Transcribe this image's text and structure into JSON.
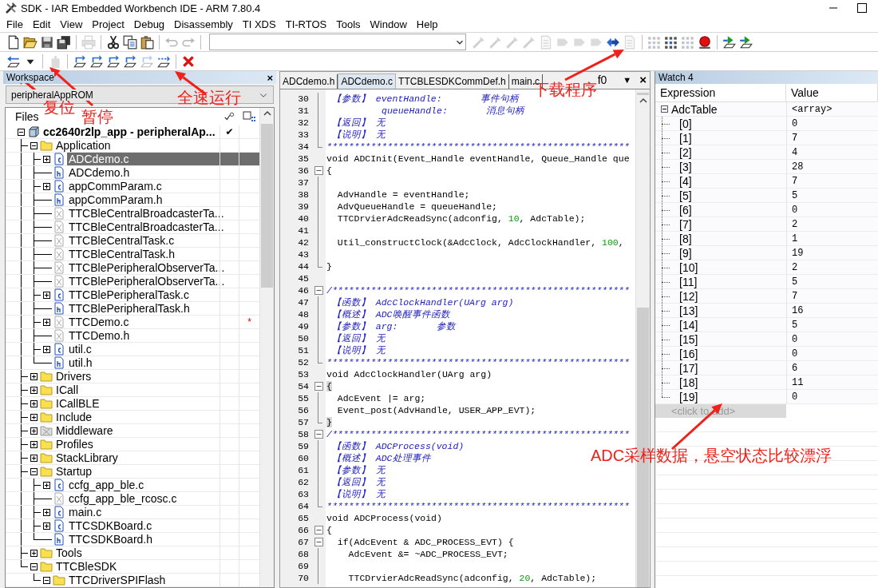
{
  "title_bar": {
    "title": "SDK - IAR Embedded Workbench IDE - ARM 7.80.4"
  },
  "menu": [
    "File",
    "Edit",
    "View",
    "Project",
    "Debug",
    "Disassembly",
    "TI XDS",
    "TI-RTOS",
    "Tools",
    "Window",
    "Help"
  ],
  "toolbars": [
    [
      {
        "kind": "new",
        "disabled": false
      },
      {
        "kind": "open",
        "disabled": false
      },
      {
        "kind": "save",
        "disabled": false
      },
      {
        "kind": "save_all",
        "disabled": false
      },
      {
        "kind": "sep"
      },
      {
        "kind": "print",
        "disabled": true
      },
      {
        "kind": "sep"
      },
      {
        "kind": "cut",
        "disabled": false
      },
      {
        "kind": "copy",
        "disabled": false
      },
      {
        "kind": "paste",
        "disabled": false
      },
      {
        "kind": "sep"
      },
      {
        "kind": "undo",
        "disabled": true
      },
      {
        "kind": "redo",
        "disabled": true
      },
      {
        "kind": "sep"
      },
      {
        "kind": "combo"
      },
      {
        "kind": "wand",
        "disabled": true
      },
      {
        "kind": "wand",
        "disabled": true
      },
      {
        "kind": "wand",
        "disabled": true
      },
      {
        "kind": "wand",
        "disabled": true
      },
      {
        "kind": "doc",
        "disabled": true
      },
      {
        "kind": "tag",
        "disabled": true
      },
      {
        "kind": "tag",
        "disabled": true
      },
      {
        "kind": "tag",
        "disabled": true
      },
      {
        "kind": "nav",
        "disabled": false
      },
      {
        "kind": "doc",
        "disabled": true
      },
      {
        "kind": "sep"
      },
      {
        "kind": "grid",
        "disabled": true
      },
      {
        "kind": "grid",
        "disabled": false
      },
      {
        "kind": "grid",
        "disabled": true
      },
      {
        "kind": "breakpoint",
        "disabled": false
      },
      {
        "kind": "sep"
      },
      {
        "kind": "download",
        "disabled": false
      },
      {
        "kind": "download",
        "disabled": false
      }
    ],
    [
      {
        "kind": "reset",
        "disabled": false
      },
      {
        "kind": "caret",
        "disabled": false
      },
      {
        "kind": "sep"
      },
      {
        "kind": "hand",
        "disabled": true
      },
      {
        "kind": "sep"
      },
      {
        "kind": "step",
        "disabled": false
      },
      {
        "kind": "step",
        "disabled": false
      },
      {
        "kind": "step",
        "disabled": false
      },
      {
        "kind": "step",
        "disabled": false
      },
      {
        "kind": "step",
        "disabled": true
      },
      {
        "kind": "run",
        "disabled": false
      },
      {
        "kind": "sep"
      },
      {
        "kind": "stop",
        "disabled": false
      }
    ]
  ],
  "workspace": {
    "title": "Workspace",
    "close": "×",
    "configuration": "peripheralAppROM",
    "files_header": "Files",
    "tree": [
      {
        "label": "cc2640r2lp_app - peripheralAp...",
        "kind": "project",
        "expanded": true,
        "selected": false,
        "check": "✔",
        "children": [
          {
            "label": "Application",
            "kind": "folder",
            "expanded": true,
            "selected": false,
            "children": [
              {
                "label": "ADCdemo.c",
                "kind": "c",
                "expanded": false,
                "selected": true
              },
              {
                "label": "ADCdemo.h",
                "kind": "h",
                "selected": false
              },
              {
                "label": "appCommParam.c",
                "kind": "c",
                "expanded": false,
                "selected": false
              },
              {
                "label": "appCommParam.h",
                "kind": "h",
                "selected": false
              },
              {
                "label": "TTCBleCentralBroadcasterTa...",
                "kind": "excluded",
                "selected": false
              },
              {
                "label": "TTCBleCentralBroadcasterTa...",
                "kind": "excluded",
                "selected": false
              },
              {
                "label": "TTCBleCentralTask.c",
                "kind": "excluded",
                "selected": false
              },
              {
                "label": "TTCBleCentralTask.h",
                "kind": "excluded",
                "selected": false
              },
              {
                "label": "TTCBlePeripheralObserverTa...",
                "kind": "excluded",
                "selected": false
              },
              {
                "label": "TTCBlePeripheralObserverTa...",
                "kind": "excluded",
                "selected": false
              },
              {
                "label": "TTCBlePeripheralTask.c",
                "kind": "c",
                "expanded": false,
                "selected": false
              },
              {
                "label": "TTCBlePeripheralTask.h",
                "kind": "h",
                "selected": false
              },
              {
                "label": "TTCDemo.c",
                "kind": "excluded",
                "expanded": false,
                "selected": false,
                "flag": "*"
              },
              {
                "label": "TTCDemo.h",
                "kind": "excluded",
                "selected": false
              },
              {
                "label": "util.c",
                "kind": "c",
                "expanded": false,
                "selected": false
              },
              {
                "label": "util.h",
                "kind": "h",
                "selected": false
              }
            ]
          },
          {
            "label": "Drivers",
            "kind": "folder",
            "expanded": false,
            "selected": false
          },
          {
            "label": "ICall",
            "kind": "folder",
            "expanded": false,
            "selected": false
          },
          {
            "label": "ICallBLE",
            "kind": "folder",
            "expanded": false,
            "selected": false
          },
          {
            "label": "Include",
            "kind": "folder",
            "expanded": false,
            "selected": false
          },
          {
            "label": "Middleware",
            "kind": "excluded_folder",
            "expanded": false,
            "selected": false
          },
          {
            "label": "Profiles",
            "kind": "folder",
            "expanded": false,
            "selected": false
          },
          {
            "label": "StackLibrary",
            "kind": "folder",
            "expanded": false,
            "selected": false
          },
          {
            "label": "Startup",
            "kind": "folder",
            "expanded": true,
            "selected": false,
            "children": [
              {
                "label": "ccfg_app_ble.c",
                "kind": "c",
                "expanded": false,
                "selected": false
              },
              {
                "label": "ccfg_app_ble_rcosc.c",
                "kind": "excluded",
                "selected": false
              },
              {
                "label": "main.c",
                "kind": "c",
                "expanded": false,
                "selected": false
              },
              {
                "label": "TTCSDKBoard.c",
                "kind": "c",
                "expanded": false,
                "selected": false
              },
              {
                "label": "TTCSDKBoard.h",
                "kind": "h",
                "selected": false
              }
            ]
          },
          {
            "label": "Tools",
            "kind": "folder",
            "expanded": false,
            "selected": false
          },
          {
            "label": "TTCBleSDK",
            "kind": "folder",
            "expanded": true,
            "selected": false,
            "children": [
              {
                "label": "TTCDriverSPIFlash",
                "kind": "folder",
                "expanded": true,
                "selected": false
              }
            ]
          }
        ]
      }
    ]
  },
  "editor": {
    "tabs": [
      {
        "label": "ADCdemo.h",
        "selected": false
      },
      {
        "label": "ADCdemo.c",
        "selected": true
      },
      {
        "label": "TTCBLESDKCommDef.h",
        "selected": false
      },
      {
        "label": "main.c",
        "selected": false
      }
    ],
    "function_box": "f0",
    "menu_glyph": "▼",
    "close": "×",
    "lines": [
      {
        "number": "30",
        "in_fold": true,
        "segments": [
          {
            "kind": "comment",
            "text": " 【参数】 eventHandle:       事件句柄"
          }
        ]
      },
      {
        "number": "31",
        "in_fold": true,
        "segments": [
          {
            "kind": "comment",
            "text": "          queueHandle:       消息句柄"
          }
        ]
      },
      {
        "number": "32",
        "in_fold": true,
        "segments": [
          {
            "kind": "comment",
            "text": " 【返回】 无"
          }
        ]
      },
      {
        "number": "33",
        "in_fold": true,
        "segments": [
          {
            "kind": "comment",
            "text": " 【说明】 无"
          }
        ]
      },
      {
        "number": "34",
        "fold_end": true,
        "segments": [
          {
            "kind": "comment",
            "text": "*******************************************************"
          }
        ]
      },
      {
        "number": "35",
        "segments": [
          {
            "kind": "code",
            "text": "void ADCInit(Event_Handle eventHandle, Queue_Handle que"
          }
        ]
      },
      {
        "number": "36",
        "fold_start": true,
        "segments": [
          {
            "kind": "code",
            "text": "{"
          }
        ]
      },
      {
        "number": "37",
        "in_fold": true
      },
      {
        "number": "38",
        "in_fold": true,
        "segments": [
          {
            "kind": "code",
            "text": "  AdvHandle = eventHandle;"
          }
        ]
      },
      {
        "number": "39",
        "in_fold": true,
        "segments": [
          {
            "kind": "code",
            "text": "  AdvQueueHandle = queueHandle;"
          }
        ]
      },
      {
        "number": "40",
        "in_fold": true,
        "segments": [
          {
            "kind": "code",
            "text": "  TTCDrvierAdcReadSync(adconfig, "
          },
          {
            "kind": "number",
            "text": "10"
          },
          {
            "kind": "code",
            "text": ", AdcTable);"
          }
        ]
      },
      {
        "number": "41",
        "in_fold": true
      },
      {
        "number": "42",
        "in_fold": true,
        "segments": [
          {
            "kind": "code",
            "text": "  Util_constructClock(&AdcClock, AdcClockHandler, "
          },
          {
            "kind": "number",
            "text": "100"
          },
          {
            "kind": "code",
            "text": ","
          }
        ]
      },
      {
        "number": "43",
        "in_fold": true
      },
      {
        "number": "44",
        "fold_end": true,
        "segments": [
          {
            "kind": "code",
            "text": "}"
          }
        ]
      },
      {
        "number": "45"
      },
      {
        "number": "46",
        "fold_start": true,
        "segments": [
          {
            "kind": "comment",
            "text": "/******************************************************"
          }
        ]
      },
      {
        "number": "47",
        "in_fold": true,
        "segments": [
          {
            "kind": "comment",
            "text": " 【函数】 AdcClockHandler(UArg arg)"
          }
        ]
      },
      {
        "number": "48",
        "in_fold": true,
        "segments": [
          {
            "kind": "comment",
            "text": " 【概述】 ADC唤醒事件函数"
          }
        ]
      },
      {
        "number": "49",
        "in_fold": true,
        "segments": [
          {
            "kind": "comment",
            "text": " 【参数】 arg:       参数"
          }
        ]
      },
      {
        "number": "50",
        "in_fold": true,
        "segments": [
          {
            "kind": "comment",
            "text": " 【返回】 无"
          }
        ]
      },
      {
        "number": "51",
        "in_fold": true,
        "segments": [
          {
            "kind": "comment",
            "text": " 【说明】 无"
          }
        ]
      },
      {
        "number": "52",
        "fold_end": true,
        "segments": [
          {
            "kind": "comment",
            "text": "*******************************************************"
          }
        ]
      },
      {
        "number": "53",
        "segments": [
          {
            "kind": "code",
            "text": "void AdcClockHandler(UArg arg)"
          }
        ]
      },
      {
        "number": "54",
        "fold_start": true,
        "segments": [
          {
            "kind": "match",
            "text": "{"
          }
        ]
      },
      {
        "number": "55",
        "in_fold": true,
        "segments": [
          {
            "kind": "code",
            "text": "  AdcEvent |= arg;"
          }
        ]
      },
      {
        "number": "56",
        "in_fold": true,
        "segments": [
          {
            "kind": "code",
            "text": "  Event_post(AdvHandle, USER_APP_EVT);"
          }
        ]
      },
      {
        "number": "57",
        "fold_end": true,
        "segments": [
          {
            "kind": "match",
            "text": "}"
          }
        ]
      },
      {
        "number": "58",
        "fold_start": true,
        "segments": [
          {
            "kind": "comment",
            "text": "/******************************************************"
          }
        ]
      },
      {
        "number": "59",
        "in_fold": true,
        "segments": [
          {
            "kind": "comment",
            "text": " 【函数】 ADCProcess(void)"
          }
        ]
      },
      {
        "number": "60",
        "in_fold": true,
        "segments": [
          {
            "kind": "comment",
            "text": " 【概述】 ADC处理事件"
          }
        ]
      },
      {
        "number": "61",
        "in_fold": true,
        "segments": [
          {
            "kind": "comment",
            "text": " 【参数】 无"
          }
        ]
      },
      {
        "number": "62",
        "in_fold": true,
        "segments": [
          {
            "kind": "comment",
            "text": " 【返回】 无"
          }
        ]
      },
      {
        "number": "63",
        "in_fold": true,
        "segments": [
          {
            "kind": "comment",
            "text": " 【说明】 无"
          }
        ]
      },
      {
        "number": "64",
        "fold_end": true,
        "segments": [
          {
            "kind": "comment",
            "text": "*******************************************************"
          }
        ]
      },
      {
        "number": "65",
        "segments": [
          {
            "kind": "code",
            "text": "void ADCProcess(void)"
          }
        ]
      },
      {
        "number": "66",
        "fold_start": true,
        "segments": [
          {
            "kind": "code",
            "text": "{"
          }
        ]
      },
      {
        "number": "67",
        "fold_start": true,
        "segments": [
          {
            "kind": "code",
            "text": "  if(AdcEvent & ADC_PROCESS_EVT) {"
          }
        ]
      },
      {
        "number": "68",
        "in_fold": true,
        "segments": [
          {
            "kind": "code",
            "text": "    AdcEvent &= ~ADC_PROCESS_EVT;"
          }
        ]
      },
      {
        "number": "69",
        "in_fold": true
      },
      {
        "number": "70",
        "in_fold": true,
        "segments": [
          {
            "kind": "code",
            "text": "    TTCDrvierAdcReadSync(adconfig, "
          },
          {
            "kind": "number",
            "text": "20"
          },
          {
            "kind": "code",
            "text": ", AdcTable);"
          }
        ]
      }
    ]
  },
  "watch": {
    "title": "Watch 4",
    "columns": [
      "Expression",
      "Value"
    ],
    "rows": [
      {
        "expression": "AdcTable",
        "value": "<array>",
        "expanded": true,
        "children": [
          {
            "expression": "[0]",
            "value": "0"
          },
          {
            "expression": "[1]",
            "value": "7"
          },
          {
            "expression": "[2]",
            "value": "4"
          },
          {
            "expression": "[3]",
            "value": "28"
          },
          {
            "expression": "[4]",
            "value": "7"
          },
          {
            "expression": "[5]",
            "value": "5"
          },
          {
            "expression": "[6]",
            "value": "0"
          },
          {
            "expression": "[7]",
            "value": "2"
          },
          {
            "expression": "[8]",
            "value": "1"
          },
          {
            "expression": "[9]",
            "value": "19"
          },
          {
            "expression": "[10]",
            "value": "2"
          },
          {
            "expression": "[11]",
            "value": "5"
          },
          {
            "expression": "[12]",
            "value": "7"
          },
          {
            "expression": "[13]",
            "value": "16"
          },
          {
            "expression": "[14]",
            "value": "5"
          },
          {
            "expression": "[15]",
            "value": "0"
          },
          {
            "expression": "[16]",
            "value": "0"
          },
          {
            "expression": "[17]",
            "value": "6"
          },
          {
            "expression": "[18]",
            "value": "11"
          },
          {
            "expression": "[19]",
            "value": "0"
          }
        ]
      }
    ],
    "add_placeholder": "<click to add>"
  },
  "annotations": [
    {
      "text": "复位"
    },
    {
      "text": "暂停"
    },
    {
      "text": "全速运行"
    },
    {
      "text": "下载程序"
    },
    {
      "text": "ADC采样数据，悬空状态比较漂浮"
    }
  ]
}
